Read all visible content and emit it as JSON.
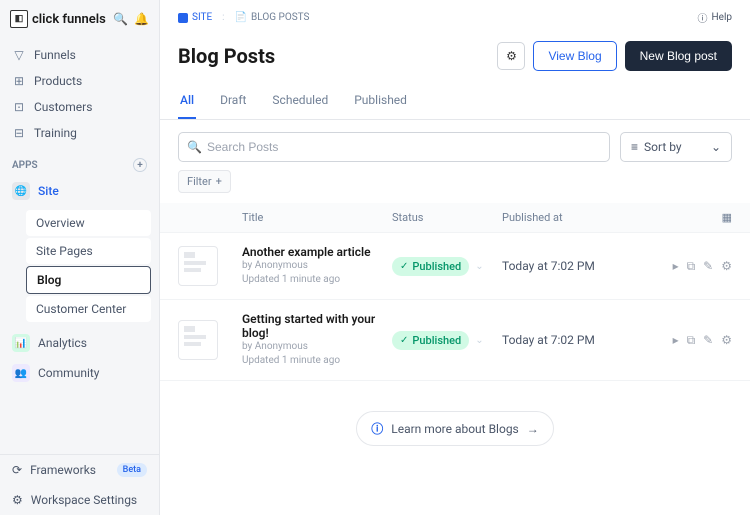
{
  "brand": {
    "name": "click funnels"
  },
  "sidebar": {
    "nav": [
      {
        "label": "Funnels",
        "icon": "▽"
      },
      {
        "label": "Products",
        "icon": "⊞"
      },
      {
        "label": "Customers",
        "icon": "⊡"
      },
      {
        "label": "Training",
        "icon": "⊟"
      }
    ],
    "apps_header": "APPS",
    "apps": {
      "site": {
        "label": "Site",
        "children": [
          {
            "label": "Overview"
          },
          {
            "label": "Site Pages"
          },
          {
            "label": "Blog"
          },
          {
            "label": "Customer Center"
          }
        ]
      },
      "analytics": {
        "label": "Analytics"
      },
      "community": {
        "label": "Community"
      }
    },
    "bottom": {
      "frameworks": "Frameworks",
      "frameworks_badge": "Beta",
      "workspace": "Workspace Settings"
    }
  },
  "breadcrumb": {
    "site": "SITE",
    "section": "BLOG POSTS"
  },
  "help": "Help",
  "page": {
    "title": "Blog Posts",
    "view_blog": "View Blog",
    "new_post": "New Blog post"
  },
  "tabs": [
    "All",
    "Draft",
    "Scheduled",
    "Published"
  ],
  "search": {
    "placeholder": "Search Posts"
  },
  "sort": {
    "label": "Sort by"
  },
  "filter": {
    "label": "Filter"
  },
  "columns": {
    "title": "Title",
    "status": "Status",
    "published": "Published at"
  },
  "rows": [
    {
      "title": "Another example article",
      "author": "by Anonymous",
      "updated": "Updated 1 minute ago",
      "status": "Published",
      "published_at": "Today at 7:02 PM"
    },
    {
      "title": "Getting started with your blog!",
      "author": "by Anonymous",
      "updated": "Updated 1 minute ago",
      "status": "Published",
      "published_at": "Today at 7:02 PM"
    }
  ],
  "learn_more": "Learn more about Blogs"
}
